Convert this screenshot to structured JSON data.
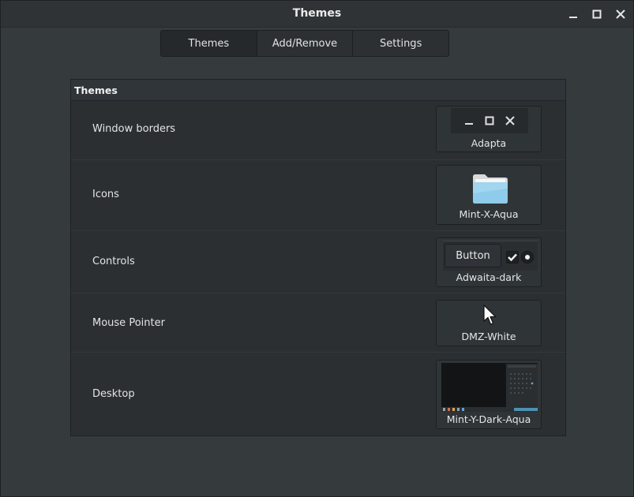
{
  "window": {
    "title": "Themes"
  },
  "stack": {
    "tabs": [
      {
        "label": "Themes",
        "active": true
      },
      {
        "label": "Add/Remove",
        "active": false
      },
      {
        "label": "Settings",
        "active": false
      }
    ]
  },
  "panel": {
    "header": "Themes",
    "rows": [
      {
        "label": "Window borders",
        "value": "Adapta"
      },
      {
        "label": "Icons",
        "value": "Mint-X-Aqua"
      },
      {
        "label": "Controls",
        "value": "Adwaita-dark",
        "preview_button": "Button"
      },
      {
        "label": "Mouse Pointer",
        "value": "DMZ-White"
      },
      {
        "label": "Desktop",
        "value": "Mint-Y-Dark-Aqua"
      }
    ]
  },
  "colors": {
    "accent": "#5aa9d6",
    "folder": "#8fcbea"
  },
  "icons": [
    "minimize-icon",
    "maximize-icon",
    "close-icon",
    "folder-icon",
    "pointer-icon",
    "checkbox-icon",
    "radio-icon"
  ]
}
